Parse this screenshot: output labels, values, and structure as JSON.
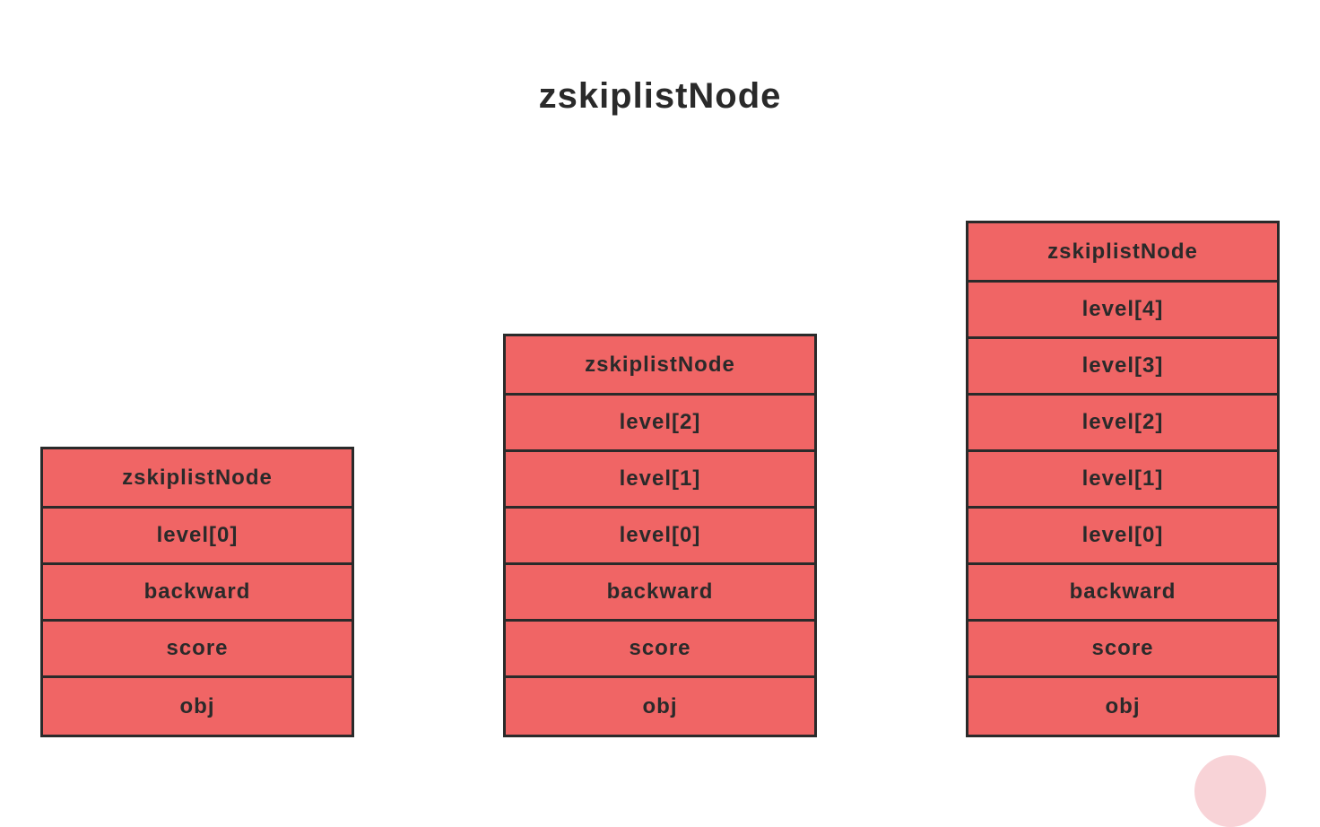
{
  "title": "zskiplistNode",
  "nodes": [
    {
      "header": "zskiplistNode",
      "cells": [
        "level[0]",
        "backward",
        "score",
        "obj"
      ]
    },
    {
      "header": "zskiplistNode",
      "cells": [
        "level[2]",
        "level[1]",
        "level[0]",
        "backward",
        "score",
        "obj"
      ]
    },
    {
      "header": "zskiplistNode",
      "cells": [
        "level[4]",
        "level[3]",
        "level[2]",
        "level[1]",
        "level[0]",
        "backward",
        "score",
        "obj"
      ]
    }
  ]
}
